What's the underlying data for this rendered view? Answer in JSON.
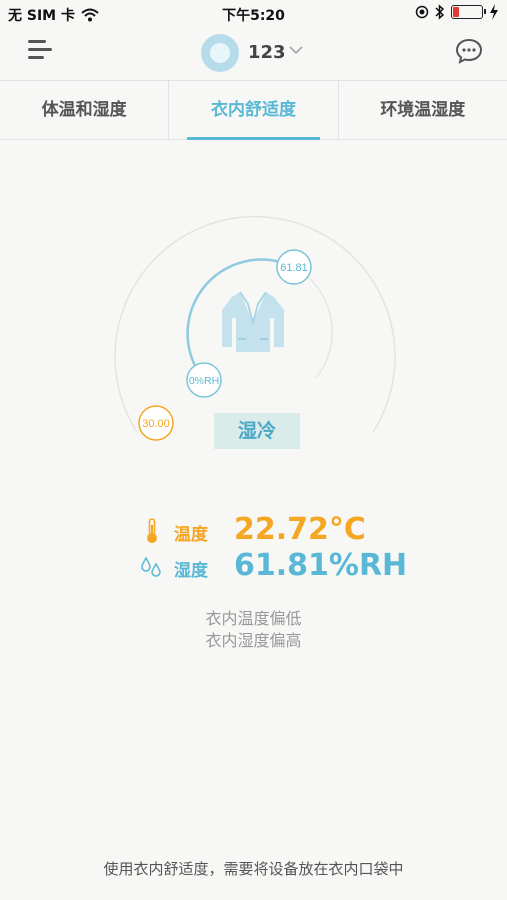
{
  "status_bar": {
    "carrier": "无 SIM 卡",
    "time": "下午5:20"
  },
  "header": {
    "device_name": "123"
  },
  "tabs": [
    {
      "label": "体温和湿度",
      "active": false
    },
    {
      "label": "衣内舒适度",
      "active": true
    },
    {
      "label": "环境温湿度",
      "active": false
    }
  ],
  "gauge": {
    "humidity_marker": "61.81",
    "humidity_axis_marker": "0%RH",
    "temperature_marker": "30.00",
    "status": "湿冷"
  },
  "readings": {
    "temperature": {
      "label": "温度",
      "value": "22.72°C",
      "color": "#f5a623"
    },
    "humidity": {
      "label": "湿度",
      "value": "61.81%RH",
      "color": "#58b8d6"
    }
  },
  "notes": [
    "衣内温度偏低",
    "衣内湿度偏高"
  ],
  "footer": "使用衣内舒适度，需要将设备放在衣内口袋中",
  "colors": {
    "accent": "#58b8d6",
    "orange": "#f5a623",
    "status_bg": "#d9ecea"
  },
  "icons": [
    "wifi-icon",
    "location-icon",
    "bluetooth-icon",
    "battery-icon",
    "charging-icon",
    "menu-icon",
    "chevron-down-icon",
    "chat-icon",
    "jacket-icon",
    "thermometer-icon",
    "humidity-icon"
  ]
}
